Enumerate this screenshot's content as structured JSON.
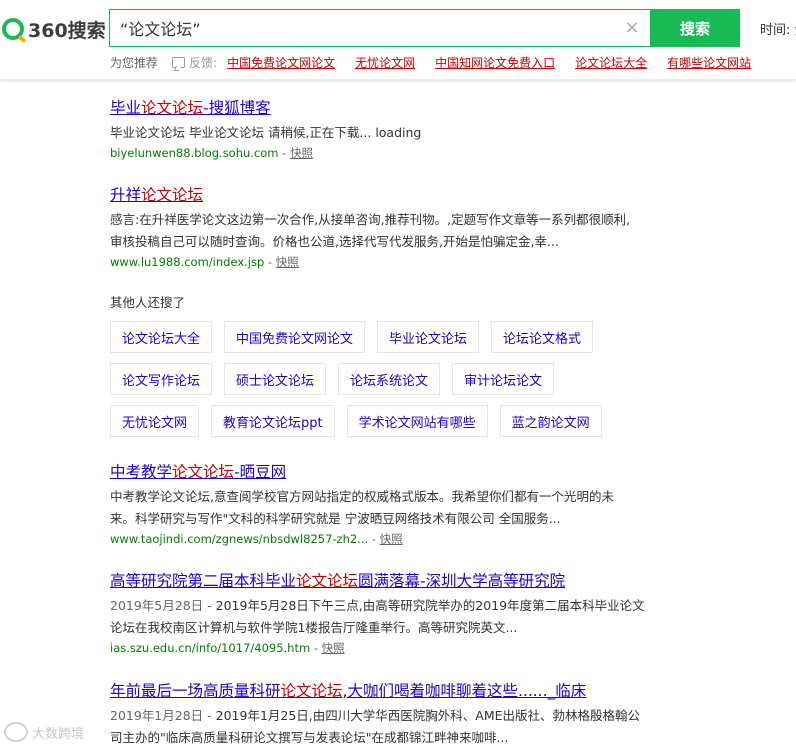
{
  "header": {
    "logo_text": "360搜索",
    "search_query": "“论文论坛”",
    "search_button": "搜索",
    "time_label": "时间: 全",
    "clear_icon": "close-icon"
  },
  "recommend": {
    "label": "为您推荐",
    "feedback_label": "反馈:",
    "links": [
      "中国免费论文网论文",
      "无忧论文网",
      "中国知网论文免费入口",
      "论文论坛大全",
      "有哪些论文网站"
    ]
  },
  "results": [
    {
      "title": [
        "毕业",
        "论文论坛",
        "-搜狐博客"
      ],
      "desc": "毕业论文论坛 毕业论文论坛 请稍候,正在下载... loading",
      "url": "biyelunwen88.blog.sohu.com",
      "snapshot": "快照"
    },
    {
      "title": [
        "升祥",
        "论文论坛",
        ""
      ],
      "desc_line1": "感言:在升祥医学论文这边第一次合作,从接单咨询,推荐刊物。,定题写作文章等一系列都很顺利,",
      "desc_line2": "审核投稿自己可以随时查询。价格也公道,选择代写代发服务,开始是怕骗定金,幸...",
      "url": "www.lu1988.com/index.jsp",
      "snapshot": "快照"
    },
    {
      "title": [
        "中考教学",
        "论文论坛",
        "-晒豆网"
      ],
      "desc_line1": "中考教学论文论坛,意查阅学校官方网站指定的权威格式版本。我希望你们都有一个光明的未",
      "desc_line2": "来。科学研究与写作\"文科的科学研究就是 宁波晒豆网络技术有限公司 全国服务...",
      "url": "www.taojindi.com/zgnews/nbsdwl8257-zh2...",
      "snapshot": "快照"
    },
    {
      "title": [
        "高等研究院第二届本科毕业",
        "论文论坛",
        "圆满落幕-深圳大学高等研究院"
      ],
      "date": "2019年5月28日",
      "desc_line1": "2019年5月28日下午三点,由高等研究院举办的2019年度第二届本科毕业论文",
      "desc_line2": "论坛在我校南区计算机与软件学院1楼报告厅隆重举行。高等研究院英文...",
      "url": "ias.szu.edu.cn/info/1017/4095.htm",
      "snapshot": "快照"
    },
    {
      "title": [
        "年前最后一场高质量科研",
        "论文论坛",
        ",大咖们喝着咖啡聊着这些......_临床"
      ],
      "date": "2019年1月28日",
      "desc_line1": "2019年1月25日,由四川大学华西医院胸外科、AME出版社、勃林格殷格翰公",
      "desc_line2": "司主办的\"临床高质量科研论文撰写与发表论坛\"在成都锦江畔神来咖啡..."
    }
  ],
  "related": {
    "title": "其他人还搜了",
    "row1": [
      "论文论坛大全",
      "中国免费论文网论文",
      "毕业论文论坛",
      "论坛论文格式"
    ],
    "row2": [
      "论文写作论坛",
      "硕士论文论坛",
      "论坛系统论文",
      "审计论坛论文"
    ],
    "row3": [
      "无忧论文网",
      "教育论文论坛ppt",
      "学术论文网站有哪些",
      "蓝之韵论文网"
    ]
  },
  "watermark": "大数跨境",
  "colors": {
    "brand_green": "#19b955",
    "link_blue": "#2200cc",
    "highlight_red": "#cc0000",
    "url_green": "#008000"
  }
}
